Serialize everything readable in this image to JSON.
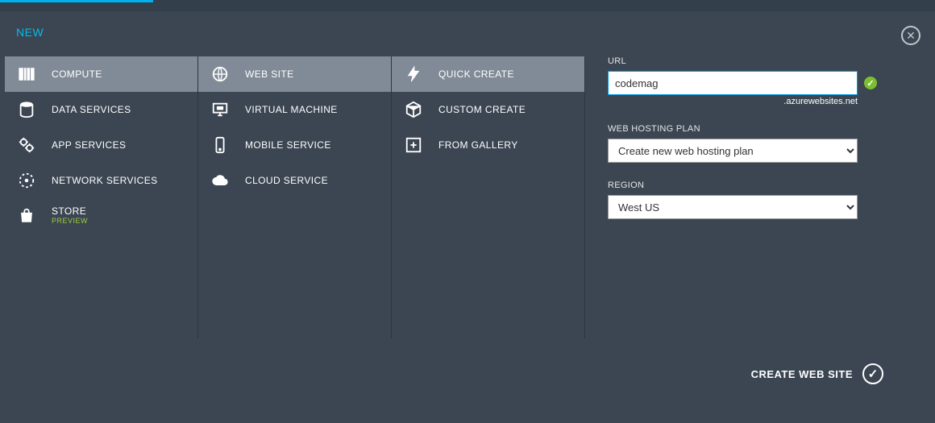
{
  "header": {
    "title": "NEW"
  },
  "col1": {
    "items": [
      {
        "label": "COMPUTE"
      },
      {
        "label": "DATA SERVICES"
      },
      {
        "label": "APP SERVICES"
      },
      {
        "label": "NETWORK SERVICES"
      },
      {
        "label": "STORE",
        "tag": "PREVIEW"
      }
    ]
  },
  "col2": {
    "items": [
      {
        "label": "WEB SITE"
      },
      {
        "label": "VIRTUAL MACHINE"
      },
      {
        "label": "MOBILE SERVICE"
      },
      {
        "label": "CLOUD SERVICE"
      }
    ]
  },
  "col3": {
    "items": [
      {
        "label": "QUICK CREATE"
      },
      {
        "label": "CUSTOM CREATE"
      },
      {
        "label": "FROM GALLERY"
      }
    ]
  },
  "form": {
    "url_label": "URL",
    "url_value": "codemag",
    "url_suffix": ".azurewebsites.net",
    "plan_label": "WEB HOSTING PLAN",
    "plan_value": "Create new web hosting plan",
    "region_label": "REGION",
    "region_value": "West US"
  },
  "footer": {
    "action_label": "CREATE WEB SITE"
  }
}
